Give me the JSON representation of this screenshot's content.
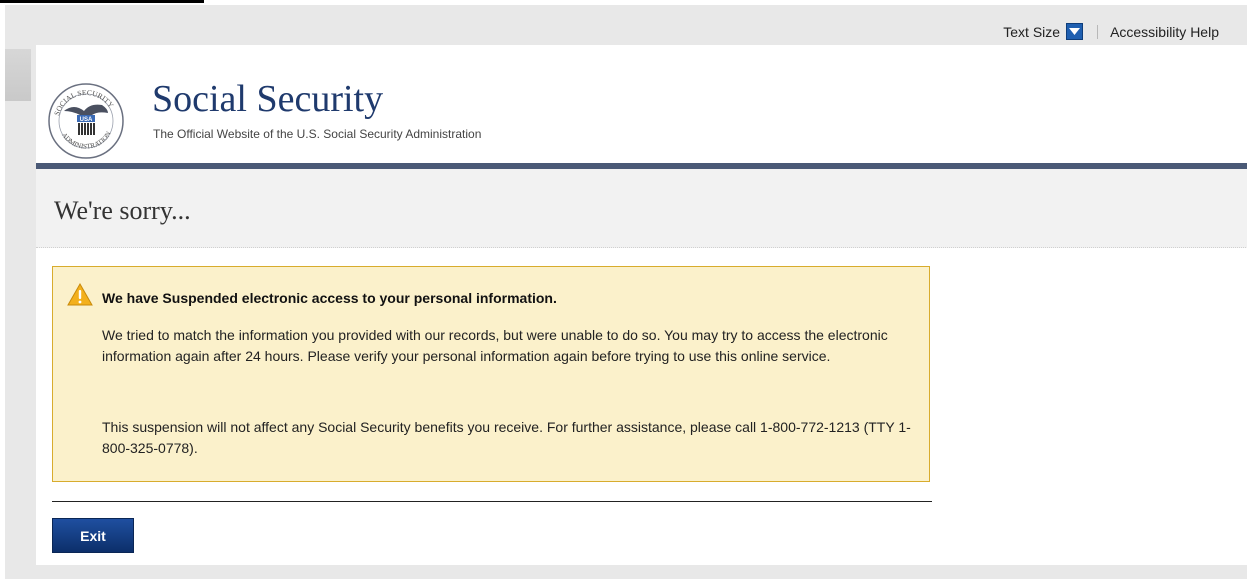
{
  "utility": {
    "text_size_label": "Text Size",
    "accessibility_label": "Accessibility Help"
  },
  "brand": {
    "title": "Social Security",
    "subtitle": "The Official Website of the U.S. Social Security Administration",
    "seal_text": "SOCIAL SECURITY ADMINISTRATION USA"
  },
  "page": {
    "title": "We're sorry..."
  },
  "alert": {
    "icon": "warning-icon",
    "heading": "We have Suspended electronic access to your personal information.",
    "paragraph1": "We tried to match the information you provided with our records, but were unable to do so. You may try to access the electronic information again after 24 hours. Please verify your personal information again before trying to use this online service.",
    "paragraph2": "This suspension will not affect any Social Security benefits you receive. For further assistance, please call 1-800-772-1213 (TTY 1-800-325-0778)."
  },
  "actions": {
    "exit_label": "Exit"
  },
  "colors": {
    "brand_navy": "#1f3a6d",
    "rule": "#4a5976",
    "alert_bg": "#fbf1cb",
    "alert_border": "#d8ac2d",
    "button": "#0c2f6a"
  }
}
